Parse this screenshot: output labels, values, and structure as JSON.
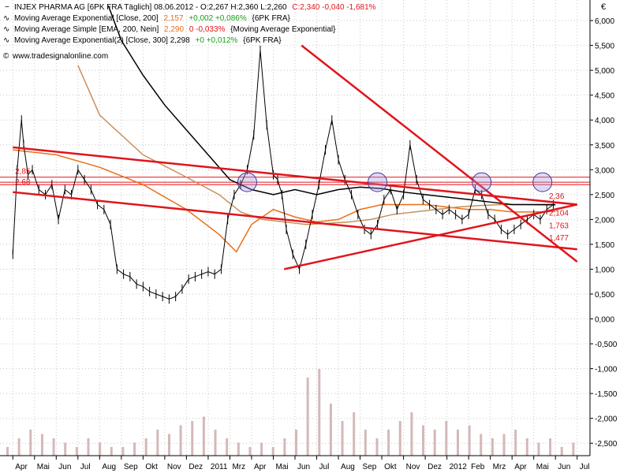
{
  "header": {
    "line1_black": "INJEX PHARMA AG [6PK FRA  Täglich] 08.06.2012 - O:2,267 H:2,360 L:2,260",
    "line1_red": "C:2,340 -0,040 -1,681%",
    "line2_black": "Moving Average Exponential [Close, 200]",
    "line2_orange": "2,157",
    "line2_green": "+0,002 +0,086%",
    "line2_tail": "{6PK FRA}",
    "line3_black": "Moving Average Simple [EMA, 200, Nein]",
    "line3_orange": "2,290",
    "line3_red": "0 -0,033%",
    "line3_tail": "{Moving Average Exponential}",
    "line4_black": "Moving Average Exponential(2) [Close, 300] 2,298",
    "line4_green": "+0 +0,012%",
    "line4_tail": "{6PK FRA}",
    "source": "www.tradesignalonline.com"
  },
  "chart_data": {
    "type": "line",
    "title": "INJEX PHARMA AG [6PK FRA  Täglich] 08.06.2012",
    "currency_label": "€",
    "ylim": [
      -2.75,
      6.35
    ],
    "y_ticks": [
      "6,000",
      "5,500",
      "5,000",
      "4,500",
      "4,000",
      "3,500",
      "3,000",
      "2,500",
      "2,000",
      "1,500",
      "1,000",
      "0,500",
      "0,000",
      "-0,500",
      "-1,000",
      "-1,500",
      "-2,000",
      "-2,500"
    ],
    "y_tick_values": [
      6,
      5.5,
      5,
      4.5,
      4,
      3.5,
      3,
      2.5,
      2,
      1.5,
      1,
      0.5,
      0,
      -0.5,
      -1,
      -1.5,
      -2,
      -2.5
    ],
    "x_ticks": [
      "Apr",
      "Mai",
      "Jun",
      "Jul",
      "Aug",
      "Sep",
      "Okt",
      "Nov",
      "Dez",
      "2011",
      "Mrz",
      "Apr",
      "Mai",
      "Jun",
      "Jul",
      "Aug",
      "Sep",
      "Okt",
      "Nov",
      "Dez",
      "2012",
      "Feb",
      "Mrz",
      "Apr",
      "Mai",
      "Jun",
      "Jul"
    ],
    "x_tick_index": [
      0,
      1,
      2,
      3,
      4,
      5,
      6,
      7,
      8,
      9,
      10,
      11,
      12,
      13,
      14,
      15,
      16,
      17,
      18,
      19,
      20,
      21,
      22,
      23,
      24,
      25,
      26
    ],
    "price_series": {
      "name": "INJEX PHARMA AG",
      "x": [
        0,
        0.2,
        0.4,
        0.5,
        0.7,
        0.9,
        1.2,
        1.5,
        1.8,
        2.1,
        2.4,
        2.7,
        3.0,
        3.3,
        3.6,
        3.9,
        4.2,
        4.5,
        4.8,
        5.1,
        5.4,
        5.7,
        6.0,
        6.3,
        6.6,
        6.9,
        7.2,
        7.5,
        7.8,
        8.1,
        8.4,
        8.7,
        9.0,
        9.3,
        9.6,
        9.9,
        10.2,
        10.5,
        10.8,
        11.1,
        11.4,
        11.7,
        12.0,
        12.2,
        12.4,
        12.6,
        12.9,
        13.2,
        13.5,
        13.8,
        14.1,
        14.4,
        14.7,
        15.0,
        15.3,
        15.6,
        15.9,
        16.2,
        16.5,
        16.8,
        17.1,
        17.4,
        17.7,
        18.0,
        18.3,
        18.6,
        18.9,
        19.2,
        19.5,
        19.8,
        20.1,
        20.4,
        20.7,
        21.0,
        21.3,
        21.6,
        21.9,
        22.2,
        22.5,
        22.8,
        23.1,
        23.4,
        23.7,
        24.0,
        24.3,
        24.6,
        24.9
      ],
      "y": [
        1.3,
        3.0,
        4.0,
        3.5,
        2.9,
        3.0,
        2.6,
        2.5,
        2.7,
        2.0,
        2.6,
        2.5,
        3.0,
        2.8,
        2.6,
        2.3,
        2.2,
        1.9,
        1.0,
        0.9,
        0.85,
        0.7,
        0.65,
        0.55,
        0.5,
        0.45,
        0.4,
        0.45,
        0.6,
        0.8,
        0.85,
        0.9,
        0.95,
        0.9,
        1.0,
        2.0,
        2.5,
        2.7,
        3.0,
        3.7,
        5.4,
        3.9,
        2.9,
        2.8,
        2.5,
        1.8,
        1.3,
        1.0,
        1.5,
        2.1,
        2.7,
        3.4,
        4.0,
        3.2,
        2.8,
        2.5,
        2.1,
        1.8,
        1.7,
        1.9,
        2.4,
        2.6,
        2.2,
        2.5,
        3.5,
        2.8,
        2.4,
        2.3,
        2.2,
        2.1,
        2.2,
        2.1,
        2.0,
        2.1,
        2.6,
        2.5,
        2.1,
        2.0,
        1.8,
        1.7,
        1.8,
        1.9,
        2.0,
        2.1,
        2.0,
        2.2,
        2.3
      ]
    },
    "moving_averages": [
      {
        "name": "Moving Average Exponential [Close, 200]",
        "color": "#e8701a",
        "x": [
          0,
          2,
          4,
          6,
          8,
          9.5,
          10.3,
          11,
          12,
          13,
          14,
          15,
          16,
          17,
          18,
          19,
          20,
          21,
          22,
          23,
          24,
          25
        ],
        "y": [
          3.4,
          3.3,
          3.05,
          2.7,
          2.2,
          1.7,
          1.35,
          1.9,
          2.2,
          2.05,
          1.95,
          2.0,
          2.2,
          2.3,
          2.3,
          2.3,
          2.25,
          2.2,
          2.2,
          2.15,
          2.15,
          2.16
        ]
      },
      {
        "name": "Moving Average Simple [EMA, 200, Nein]",
        "color": "#c8905a",
        "x": [
          3,
          4,
          6,
          8,
          9.5,
          10.5,
          11.5,
          12.5,
          13.5,
          14.5,
          15.5,
          16.5,
          17.5,
          18.5,
          19.5,
          20.5,
          21.5,
          22.5,
          23.5,
          24.5,
          25
        ],
        "y": [
          5.1,
          4.1,
          3.3,
          2.85,
          2.5,
          2.15,
          2.0,
          1.95,
          1.9,
          1.92,
          1.95,
          2.0,
          2.1,
          2.15,
          2.2,
          2.25,
          2.28,
          2.3,
          2.3,
          2.29,
          2.29
        ]
      },
      {
        "name": "Moving Average Exponential(2) [Close, 300]",
        "color": "#000000",
        "x": [
          4.4,
          5,
          6,
          7,
          8,
          9,
          10,
          11,
          12,
          13,
          14,
          15,
          16,
          17,
          18,
          19,
          20,
          21,
          22,
          23,
          24,
          25
        ],
        "y": [
          6.3,
          5.6,
          4.9,
          4.3,
          3.8,
          3.3,
          2.8,
          2.6,
          2.5,
          2.6,
          2.5,
          2.6,
          2.65,
          2.62,
          2.55,
          2.5,
          2.45,
          2.4,
          2.35,
          2.3,
          2.3,
          2.3
        ]
      }
    ],
    "horizontal_lines": [
      2.85,
      2.75,
      2.7
    ],
    "trend_lines": [
      {
        "from": [
          0,
          3.45
        ],
        "to": [
          26,
          2.3
        ]
      },
      {
        "from": [
          0,
          2.55
        ],
        "to": [
          26,
          1.4
        ]
      },
      {
        "from": [
          12.5,
          1.0
        ],
        "to": [
          26,
          2.3
        ]
      },
      {
        "from": [
          13.3,
          5.5
        ],
        "to": [
          26,
          1.15
        ]
      }
    ],
    "circles": [
      {
        "x": 10.8,
        "y": 2.75
      },
      {
        "x": 16.8,
        "y": 2.75
      },
      {
        "x": 21.6,
        "y": 2.75
      },
      {
        "x": 24.4,
        "y": 2.75
      }
    ],
    "volume": [
      0.1,
      0.2,
      0.3,
      0.25,
      0.2,
      0.15,
      0.1,
      0.2,
      0.15,
      0.1,
      0.1,
      0.15,
      0.2,
      0.3,
      0.25,
      0.35,
      0.4,
      0.45,
      0.3,
      0.2,
      0.15,
      0.1,
      0.15,
      0.1,
      0.2,
      0.3,
      0.9,
      1.0,
      0.6,
      0.4,
      0.5,
      0.3,
      0.2,
      0.3,
      0.4,
      0.5,
      0.35,
      0.3,
      0.4,
      0.3,
      0.35,
      0.25,
      0.2,
      0.25,
      0.3,
      0.2,
      0.15,
      0.2,
      0.1,
      0.15
    ],
    "annotations": [
      {
        "text": "2,36",
        "x": 24.7,
        "y": 2.42
      },
      {
        "text": "2,104",
        "x": 24.7,
        "y": 2.08
      },
      {
        "text": "1,763",
        "x": 24.7,
        "y": 1.82
      },
      {
        "text": "1,477",
        "x": 24.7,
        "y": 1.58
      },
      {
        "text": "2,85",
        "x": 0.1,
        "y": 2.92
      },
      {
        "text": "2,68",
        "x": 0.1,
        "y": 2.7
      }
    ]
  }
}
